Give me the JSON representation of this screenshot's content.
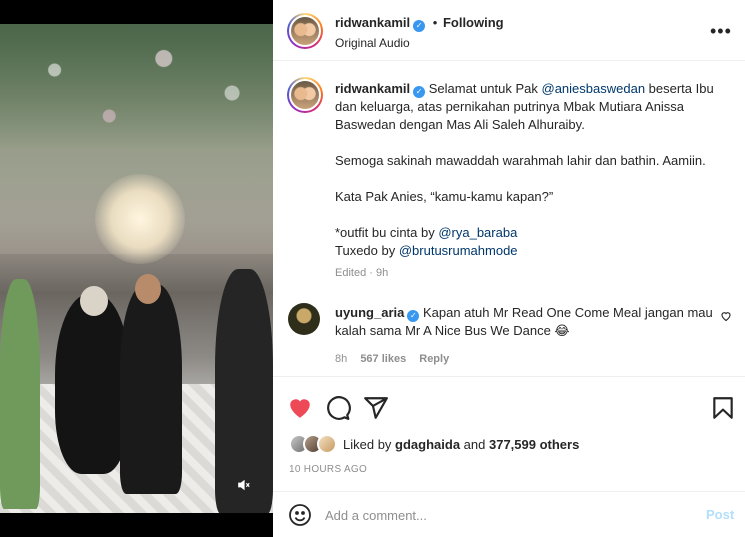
{
  "post": {
    "username": "ridwankamil",
    "follow_dot": "•",
    "follow_status": "Following",
    "audio": "Original Audio",
    "more_icon": "more-horizontal-icon"
  },
  "caption": {
    "username": "ridwankamil",
    "p1_a": "Selamat untuk Pak ",
    "p1_mention": "@aniesbaswedan",
    "p1_b": " beserta Ibu dan keluarga, atas pernikahan putrinya Mbak Mutiara Anissa Baswedan dengan Mas Ali Saleh Alhuraiby.",
    "p2": "Semoga sakinah mawaddah warahmah lahir dan bathin. Aamiin.",
    "p3": "Kata Pak Anies, “kamu-kamu kapan?”",
    "p4_a": "*outfit bu cinta by ",
    "p4_mention": "@rya_baraba",
    "p5_a": "Tuxedo by ",
    "p5_mention": "@brutusrumahmode",
    "edited": "Edited · 9h"
  },
  "comment": {
    "username": "uyung_aria",
    "text": "Kapan atuh Mr Read One Come Meal jangan mau kalah sama Mr A Nice Bus We Dance 😂",
    "time": "8h",
    "likes": "567 likes",
    "reply": "Reply"
  },
  "likes": {
    "prefix": "Liked by ",
    "user": "gdaghaida",
    "middle": " and ",
    "count": "377,599 others"
  },
  "timestamp": "10 HOURS AGO",
  "add_comment": {
    "placeholder": "Add a comment...",
    "post_label": "Post"
  },
  "colors": {
    "like_red": "#ed4956",
    "verified_blue": "#3897f0",
    "link_blue": "#00376b",
    "post_disabled": "#b2dffc"
  }
}
